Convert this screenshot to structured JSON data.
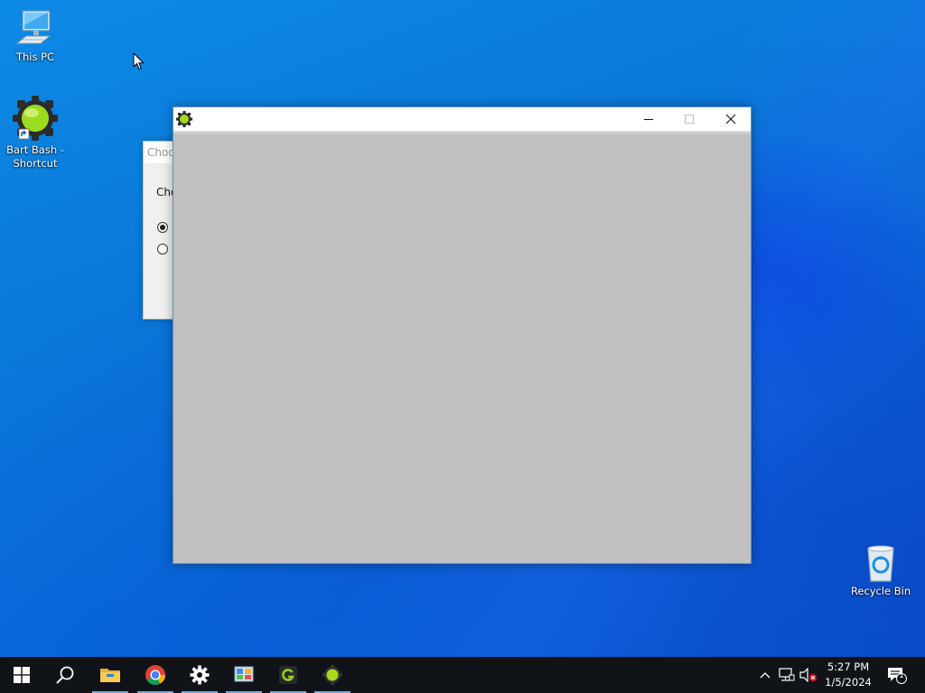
{
  "desktop": {
    "icons": [
      {
        "label": "This PC",
        "icon": "computer-icon"
      },
      {
        "label": "Bart Bash -\nShortcut",
        "icon": "bart-bash-icon"
      },
      {
        "label": "Recycle Bin",
        "icon": "recycle-bin-icon"
      }
    ]
  },
  "choose_dialog": {
    "title": "Choo",
    "prompt": "Cho",
    "options": [
      {
        "selected": true
      },
      {
        "selected": false
      }
    ]
  },
  "main_window": {
    "title": "",
    "icon": "bart-bash-gear-icon",
    "client_color": "#c0c0c0",
    "controls": [
      "minimize-icon",
      "maximize-icon",
      "close-icon"
    ]
  },
  "taskbar": {
    "items": [
      {
        "name": "start",
        "icon": "windows-logo-icon"
      },
      {
        "name": "search",
        "icon": "search-icon"
      },
      {
        "name": "file-explorer",
        "icon": "folder-icon"
      },
      {
        "name": "chrome",
        "icon": "chrome-icon"
      },
      {
        "name": "settings",
        "icon": "gear-icon"
      },
      {
        "name": "control-panel",
        "icon": "control-panel-icon"
      },
      {
        "name": "greenshot",
        "icon": "greenshot-icon"
      },
      {
        "name": "bart-bash",
        "icon": "bart-bash-icon"
      }
    ],
    "tray": {
      "icons": [
        "chevron-up-icon",
        "network-icon",
        "volume-muted-icon"
      ],
      "time": "5:27 PM",
      "date": "1/5/2024",
      "notification_count": "1"
    }
  },
  "colors": {
    "desktop_accent": "#0a78d8",
    "taskbar": "#101418",
    "window_client": "#c0c0c0"
  }
}
